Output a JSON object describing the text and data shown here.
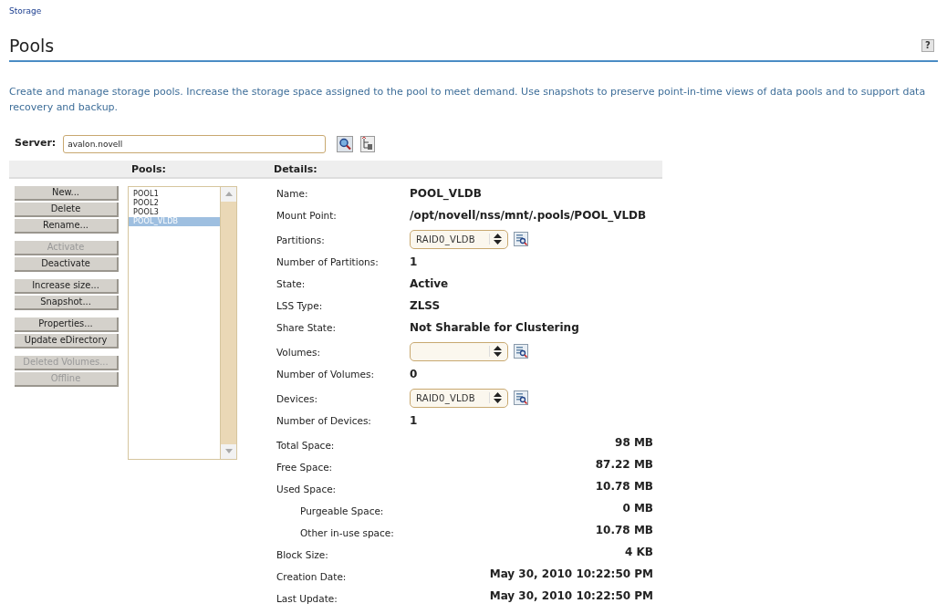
{
  "breadcrumb": "Storage",
  "title": "Pools",
  "help": "?",
  "description": "Create and manage storage pools. Increase the storage space assigned to the pool to meet demand. Use snapshots to preserve point-in-time views of data pools and to support data recovery and backup.",
  "server": {
    "label": "Server:",
    "value": "avalon.novell"
  },
  "pools_header": "Pools:",
  "details_header": "Details:",
  "button_groups": [
    [
      {
        "label": "New...",
        "disabled": false
      },
      {
        "label": "Delete",
        "disabled": false
      },
      {
        "label": "Rename...",
        "disabled": false
      }
    ],
    [
      {
        "label": "Activate",
        "disabled": true
      },
      {
        "label": "Deactivate",
        "disabled": false
      }
    ],
    [
      {
        "label": "Increase size...",
        "disabled": false
      },
      {
        "label": "Snapshot...",
        "disabled": false
      }
    ],
    [
      {
        "label": "Properties...",
        "disabled": false
      },
      {
        "label": "Update eDirectory",
        "disabled": false
      }
    ],
    [
      {
        "label": "Deleted Volumes...",
        "disabled": true
      },
      {
        "label": "Offline",
        "disabled": true
      }
    ]
  ],
  "pools": [
    {
      "name": "POOL1",
      "selected": false
    },
    {
      "name": "POOL2",
      "selected": false
    },
    {
      "name": "POOL3",
      "selected": false
    },
    {
      "name": "POOL_VLDB",
      "selected": true
    }
  ],
  "details": [
    {
      "kind": "text",
      "label": "Name:",
      "value": "POOL_VLDB"
    },
    {
      "kind": "text",
      "label": "Mount Point:",
      "value": "/opt/novell/nss/mnt/.pools/POOL_VLDB"
    },
    {
      "kind": "select",
      "label": "Partitions:",
      "value": "RAID0_VLDB"
    },
    {
      "kind": "text",
      "label": "Number of Partitions:",
      "value": "1"
    },
    {
      "kind": "text",
      "label": "State:",
      "value": "Active"
    },
    {
      "kind": "text",
      "label": "LSS Type:",
      "value": "ZLSS"
    },
    {
      "kind": "text",
      "label": "Share State:",
      "value": "Not Sharable for Clustering"
    },
    {
      "kind": "select",
      "label": "Volumes:"
    },
    {
      "kind": "text",
      "label": "Number of Volumes:",
      "value": "0"
    },
    {
      "kind": "select",
      "label": "Devices:",
      "value": "RAID0_VLDB"
    },
    {
      "kind": "text",
      "label": "Number of Devices:",
      "value": "1"
    },
    {
      "kind": "amount",
      "label": "Total Space:",
      "value": "98 MB"
    },
    {
      "kind": "amount",
      "label": "Free Space:",
      "value": "87.22 MB"
    },
    {
      "kind": "amount",
      "label": "Used Space:",
      "value": "10.78 MB"
    },
    {
      "kind": "amount",
      "label": "Purgeable Space:",
      "value": "0 MB",
      "indent": true
    },
    {
      "kind": "amount",
      "label": "Other in-use space:",
      "value": "10.78 MB",
      "indent": true
    },
    {
      "kind": "amount",
      "label": "Block Size:",
      "value": "4 KB"
    },
    {
      "kind": "amount",
      "label": "Creation Date:",
      "value": "May 30, 2010 10:22:50 PM"
    },
    {
      "kind": "amount",
      "label": "Last Update:",
      "value": "May 30, 2010 10:22:50 PM"
    }
  ]
}
